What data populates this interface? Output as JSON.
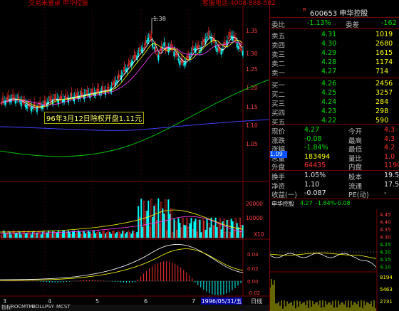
{
  "topbar": {
    "left_text": "交易未登录 申华控股",
    "hotline": "客服电话:4008-888-582"
  },
  "chart_annotation": "96年3月12日除权开盘1.11元",
  "price_max_label": "1.38",
  "price_axis": [
    "1.35",
    "1.30",
    "1.25",
    "1.20",
    "1.15",
    "1.10",
    "1.05"
  ],
  "current_price_tag": "1.09",
  "vol_axis": [
    "20000",
    "10000",
    "X10"
  ],
  "date_box": "1996/05/31/五",
  "x_ticks": [
    "3",
    "4",
    "5",
    "6",
    "7"
  ],
  "day_label": "日线",
  "bottom_tabs": [
    "指标",
    "ROC",
    "MTM",
    "BOLL",
    "PSY",
    "MCST"
  ],
  "quote": {
    "code_name": "600653 申华控股",
    "ratio": {
      "label1": "委比",
      "val1": "-1.13%",
      "label2": "委差",
      "val2": "-162"
    },
    "asks": [
      {
        "label": "卖五",
        "price": "4.31",
        "vol": "1019"
      },
      {
        "label": "卖四",
        "price": "4.30",
        "vol": "2680"
      },
      {
        "label": "卖三",
        "price": "4.29",
        "vol": "1615"
      },
      {
        "label": "卖二",
        "price": "4.28",
        "vol": "1174"
      },
      {
        "label": "卖一",
        "price": "4.27",
        "vol": "714"
      }
    ],
    "bids": [
      {
        "label": "买一",
        "price": "4.26",
        "vol": "2456"
      },
      {
        "label": "买二",
        "price": "4.25",
        "vol": "3257"
      },
      {
        "label": "买三",
        "price": "4.24",
        "vol": "284"
      },
      {
        "label": "买四",
        "price": "4.23",
        "vol": "298"
      },
      {
        "label": "买五",
        "price": "4.22",
        "vol": "590"
      }
    ],
    "stats": [
      {
        "l1": "现价",
        "v1": "4.27",
        "l2": "今开",
        "v2": "4.3"
      },
      {
        "l1": "涨跌",
        "v1": "-0.08",
        "l2": "最高",
        "v2": "4.3"
      },
      {
        "l1": "涨幅",
        "v1": "-1.84%",
        "l2": "最低",
        "v2": "4.2"
      },
      {
        "l1": "总量",
        "v1": "183494",
        "l2": "量比",
        "v2": "1.0"
      },
      {
        "l1": "外盘",
        "v1": "64435",
        "l2": "内盘",
        "v2": "11905"
      }
    ],
    "stats2": [
      {
        "l1": "换手",
        "v1": "1.05%",
        "l2": "股本",
        "v2": "19.5"
      },
      {
        "l1": "净资",
        "v1": "1.10",
        "l2": "流通",
        "v2": "17.5"
      },
      {
        "l1": "收益(一)",
        "v1": "-0.087",
        "l2": "PE(动)",
        "v2": "-"
      }
    ],
    "mini_header": {
      "name": "申华控股",
      "price": "4.27",
      "chg": "-1.84%",
      "vol": "-0.08"
    },
    "mini_axis": [
      "4.45",
      "4.40",
      "4.35",
      "4.30",
      "4.25",
      "4.20",
      "4.15",
      "4.10"
    ],
    "mini_vol_axis": [
      "8194",
      "5463",
      "2731"
    ]
  },
  "colors": {
    "up": "#ff3030",
    "down": "#00ffff",
    "ma5": "#ffffff",
    "ma10": "#ffff00",
    "ma20": "#ff40ff",
    "ma60": "#00c000",
    "ma120": "#4040ff"
  }
}
